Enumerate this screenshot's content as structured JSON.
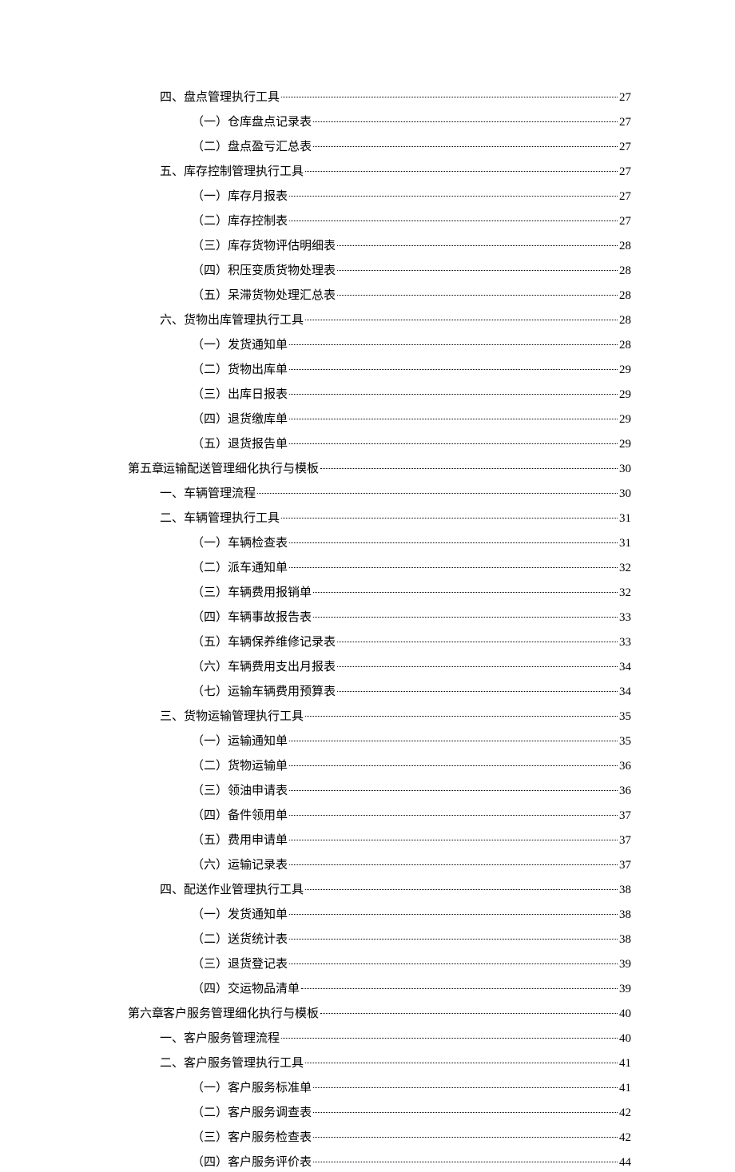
{
  "entries": [
    {
      "level": 2,
      "text": "四、盘点管理执行工具",
      "page": "27"
    },
    {
      "level": 3,
      "text": "（一）仓库盘点记录表",
      "page": "27"
    },
    {
      "level": 3,
      "text": "（二）盘点盈亏汇总表",
      "page": "27"
    },
    {
      "level": 2,
      "text": "五、库存控制管理执行工具",
      "page": "27"
    },
    {
      "level": 3,
      "text": "（一）库存月报表",
      "page": "27"
    },
    {
      "level": 3,
      "text": "（二）库存控制表",
      "page": "27"
    },
    {
      "level": 3,
      "text": "（三）库存货物评估明细表",
      "page": "28"
    },
    {
      "level": 3,
      "text": "（四）积压变质货物处理表",
      "page": "28"
    },
    {
      "level": 3,
      "text": "（五）呆滞货物处理汇总表",
      "page": "28"
    },
    {
      "level": 2,
      "text": "六、货物出库管理执行工具",
      "page": "28"
    },
    {
      "level": 3,
      "text": "（一）发货通知单",
      "page": "28"
    },
    {
      "level": 3,
      "text": "（二）货物出库单",
      "page": "29"
    },
    {
      "level": 3,
      "text": "（三）出库日报表",
      "page": "29"
    },
    {
      "level": 3,
      "text": "（四）退货缴库单",
      "page": "29"
    },
    {
      "level": 3,
      "text": "（五）退货报告单",
      "page": "29"
    },
    {
      "level": 1,
      "chapter": "第五章",
      "text": "运输配送管理细化执行与模板",
      "page": "30"
    },
    {
      "level": 2,
      "text": "一、车辆管理流程",
      "page": "30"
    },
    {
      "level": 2,
      "text": "二、车辆管理执行工具",
      "page": "31"
    },
    {
      "level": 3,
      "text": "（一）车辆检查表",
      "page": "31"
    },
    {
      "level": 3,
      "text": "（二）派车通知单",
      "page": "32"
    },
    {
      "level": 3,
      "text": "（三）车辆费用报销单",
      "page": "32"
    },
    {
      "level": 3,
      "text": "（四）车辆事故报告表",
      "page": "33"
    },
    {
      "level": 3,
      "text": "（五）车辆保养维修记录表",
      "page": "33"
    },
    {
      "level": 3,
      "text": "（六）车辆费用支出月报表",
      "page": "34"
    },
    {
      "level": 3,
      "text": "（七）运输车辆费用预算表",
      "page": "34"
    },
    {
      "level": 2,
      "text": "三、货物运输管理执行工具",
      "page": "35"
    },
    {
      "level": 3,
      "text": "（一）运输通知单",
      "page": "35"
    },
    {
      "level": 3,
      "text": "（二）货物运输单",
      "page": "36"
    },
    {
      "level": 3,
      "text": "（三）领油申请表",
      "page": "36"
    },
    {
      "level": 3,
      "text": "（四）备件领用单",
      "page": "37"
    },
    {
      "level": 3,
      "text": "（五）费用申请单",
      "page": "37"
    },
    {
      "level": 3,
      "text": "（六）运输记录表",
      "page": "37"
    },
    {
      "level": 2,
      "text": "四、配送作业管理执行工具",
      "page": "38"
    },
    {
      "level": 3,
      "text": "（一）发货通知单",
      "page": "38"
    },
    {
      "level": 3,
      "text": "（二）送货统计表",
      "page": "38"
    },
    {
      "level": 3,
      "text": "（三）退货登记表",
      "page": "39"
    },
    {
      "level": 3,
      "text": "（四）交运物品清单",
      "page": "39"
    },
    {
      "level": 1,
      "chapter": "第六章",
      "text": "客户服务管理细化执行与模板",
      "page": "40"
    },
    {
      "level": 2,
      "text": "一、客户服务管理流程",
      "page": "40"
    },
    {
      "level": 2,
      "text": "二、客户服务管理执行工具",
      "page": "41"
    },
    {
      "level": 3,
      "text": "（一）客户服务标准单",
      "page": "41"
    },
    {
      "level": 3,
      "text": "（二）客户服务调查表",
      "page": "42"
    },
    {
      "level": 3,
      "text": "（三）客户服务检查表",
      "page": "42"
    },
    {
      "level": 3,
      "text": "（四）客户服务评价表",
      "page": "44"
    }
  ]
}
